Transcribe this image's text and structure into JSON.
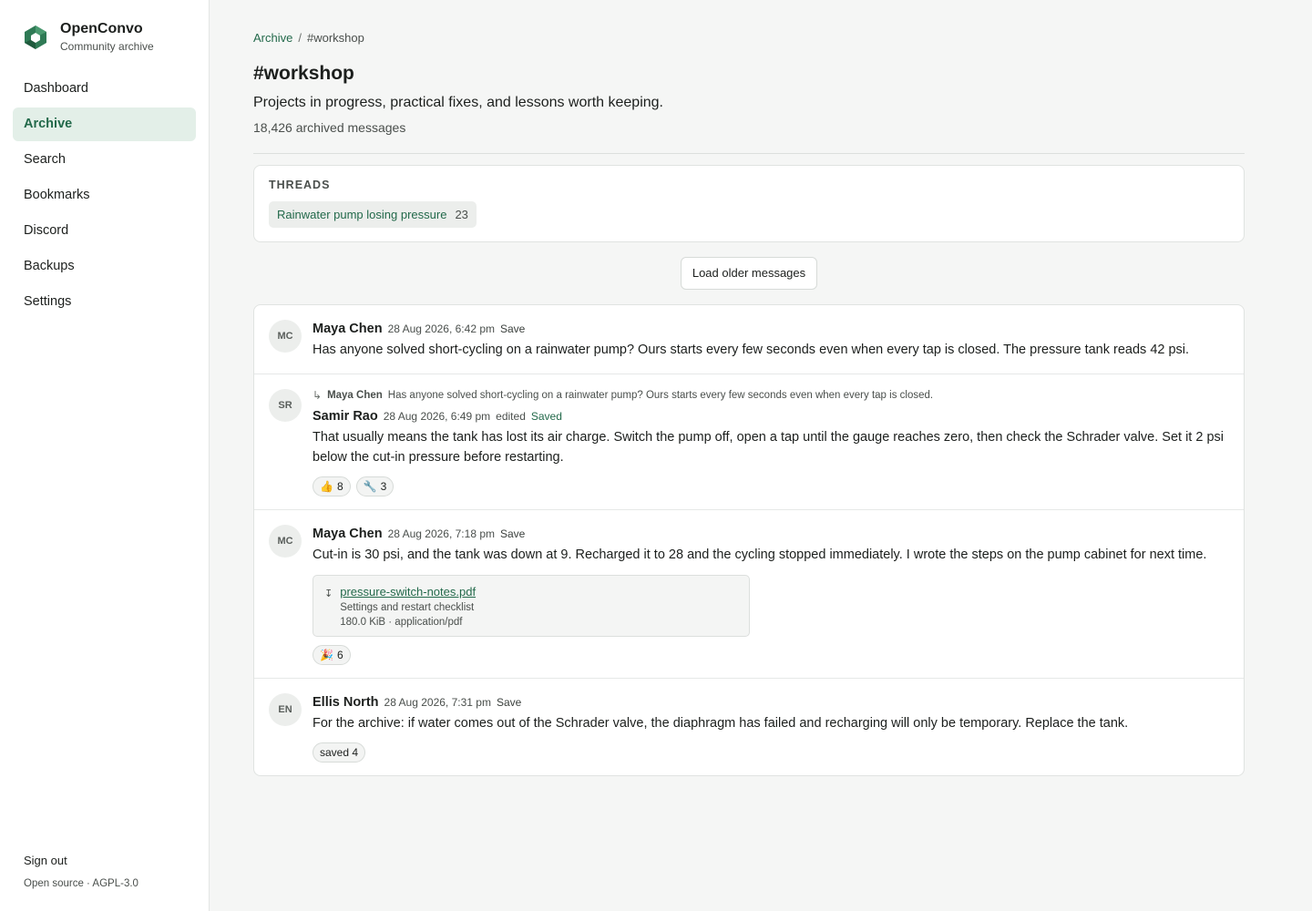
{
  "brand": {
    "name": "OpenConvo",
    "subtitle": "Community archive"
  },
  "nav": {
    "items": [
      {
        "label": "Dashboard"
      },
      {
        "label": "Archive",
        "active": true
      },
      {
        "label": "Search"
      },
      {
        "label": "Bookmarks"
      },
      {
        "label": "Discord"
      },
      {
        "label": "Backups"
      },
      {
        "label": "Settings"
      }
    ],
    "sign_out": "Sign out",
    "license": "Open source · AGPL-3.0"
  },
  "breadcrumb": {
    "root": "Archive",
    "separator": "/",
    "current": "#workshop"
  },
  "channel": {
    "title": "#workshop",
    "description": "Projects in progress, practical fixes, and lessons worth keeping.",
    "count": "18,426 archived messages"
  },
  "threads": {
    "heading": "THREADS",
    "items": [
      {
        "name": "Rainwater pump losing pressure",
        "count": "23"
      }
    ]
  },
  "load_older": "Load older messages",
  "messages": [
    {
      "initials": "MC",
      "author": "Maya Chen",
      "time": "28 Aug 2026, 6:42 pm",
      "save": "Save",
      "body": "Has anyone solved short-cycling on a rainwater pump? Ours starts every few seconds even when every tap is closed. The pressure tank reads 42 psi."
    },
    {
      "initials": "SR",
      "reply_to": {
        "arrow": "↳",
        "author": "Maya Chen",
        "text": "Has anyone solved short-cycling on a rainwater pump? Ours starts every few seconds even when every tap is closed."
      },
      "author": "Samir Rao",
      "time": "28 Aug 2026, 6:49 pm",
      "edited": "edited",
      "save": "Saved",
      "body": "That usually means the tank has lost its air charge. Switch the pump off, open a tap until the gauge reaches zero, then check the Schrader valve. Set it 2 psi below the cut-in pressure before restarting.",
      "reactions": [
        {
          "emoji": "👍",
          "count": "8"
        },
        {
          "emoji": "🔧",
          "count": "3"
        }
      ]
    },
    {
      "initials": "MC",
      "author": "Maya Chen",
      "time": "28 Aug 2026, 7:18 pm",
      "save": "Save",
      "body": "Cut-in is 30 psi, and the tank was down at 9. Recharged it to 28 and the cycling stopped immediately. I wrote the steps on the pump cabinet for next time.",
      "attachment": {
        "icon": "↧",
        "name": "pressure-switch-notes.pdf",
        "description": "Settings and restart checklist",
        "meta": "180.0 KiB · application/pdf"
      },
      "reactions": [
        {
          "emoji": "🎉",
          "count": "6"
        }
      ]
    },
    {
      "initials": "EN",
      "author": "Ellis North",
      "time": "28 Aug 2026, 7:31 pm",
      "save": "Save",
      "body": "For the archive: if water comes out of the Schrader valve, the diaphragm has failed and recharging will only be temporary. Replace the tank.",
      "reactions": [
        {
          "emoji": "",
          "count": "saved 4"
        }
      ]
    }
  ],
  "colors": {
    "accent": "#22694a",
    "active_bg": "#e3efe8",
    "background": "#f5f6f5"
  }
}
